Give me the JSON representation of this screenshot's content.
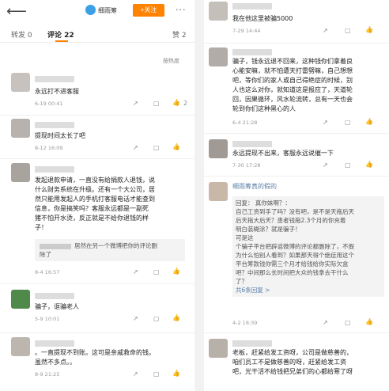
{
  "header": {
    "account": "细雨筹",
    "follow_label": "+关注",
    "more": "···"
  },
  "tabs": {
    "repost": "转发 0",
    "comments": "评论 22",
    "likes": "赞 2"
  },
  "sort_label": "按热度",
  "left_comments": [
    {
      "text": [
        "永远打不进客服"
      ],
      "time": "6-19 00:41"
    },
    {
      "text": [
        "提现时间太长了吧"
      ],
      "time": "8-12 16:09"
    },
    {
      "text": [
        "发起退款申请，一直没有给捐款人退钱，说",
        "什么财务系统在升级。还有一个大公司，居",
        "然只能用发起人的手机打客服电话才能查到",
        "信息，你是搞笑吗？客服永远都是一副死",
        "猪不怕开水烫，反正就是不给你退钱的样",
        "子！"
      ],
      "reply": [
        "居然在另一个微博把你的评论删",
        "除了"
      ],
      "time": "8-4 16:57"
    },
    {
      "text": [
        "骗子，诓骗老人"
      ],
      "time": "5-9 10:01"
    },
    {
      "text": [
        "。一直提现不到账。这可是亲戚救命的钱。",
        "虽然不多点。。"
      ],
      "time": "8-9 21:25"
    }
  ],
  "right_comments": [
    {
      "text": [
        "我在他这里被骗5000"
      ],
      "time": "7-29 14:44"
    },
    {
      "text": [
        "骗子，钱永远退不回来，这种钱你们拿着良",
        "心能安嘛，就不怕遭天打雷劈嘛，自己想想",
        "吧，等你们的家人或自己得绝症的时候，别",
        "人也这么对你，就知道这是报应了，天道轮",
        "回，因果循环，风水轮流转，总有一天也会",
        "轮到你们这种黑心的人"
      ],
      "time": "6-4 21:28"
    },
    {
      "text": [
        "永远提现不出来，客服永远说催一下"
      ],
      "time": "7-30 17:28"
    },
    {
      "name": "细雨筹真的假的",
      "reply": [
        "回复：                     真你妹啊？：",
        "自己工资到手了吗？没有吧，是不是天拖后天",
        "后天拖大后天？患者钱拖2.3个月的你充着",
        "明白装糊涂？就是骗子！",
        "                                              可是这",
        "个骗子平台把辟谣微博的评论都删除了，不假",
        "为什么怕别人看到？如果那天得个绝症用这个",
        "平台筹款钱你需三个月才给钱给你实际欠盒",
        "吧？中间那么长时间把大众的钱拿去干什么",
        "了？"
      ],
      "more": "共6条回复 >",
      "time": "4-2 16:39"
    },
    {
      "text": [
        "老板，赶紧给发工资呀，公司是做慈善的，",
        "咱们员工不是做慈善的呀，赶紧给发工资",
        "吧，光干活不给钱把兄弟们的心都给寒了呀"
      ],
      "time": ""
    }
  ],
  "actions": {
    "share": "↗",
    "reply": "▢",
    "like": "👍"
  },
  "like_counts": {
    "c1": "2",
    "c2": "",
    "c3": "",
    "c4": "",
    "c5": ""
  },
  "colors": {
    "accent": "#ff8200",
    "link": "#5a7ea6"
  }
}
